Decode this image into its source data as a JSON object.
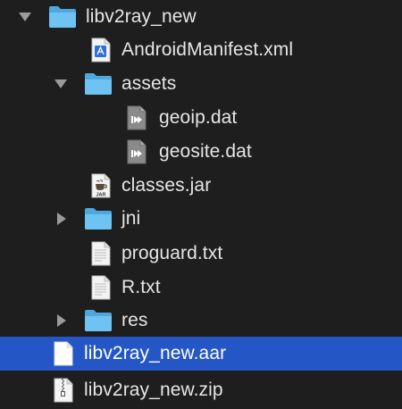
{
  "colors": {
    "background": "#1e1e1e",
    "selection": "#2457c5",
    "folder": "#6fc3f2",
    "text": "#e6e6e6"
  },
  "tree": [
    {
      "name": "libv2ray_new",
      "kind": "folder",
      "disclosure": "expanded",
      "icon": "folder-icon"
    },
    {
      "name": "AndroidManifest.xml",
      "kind": "file",
      "icon": "xml-file-icon"
    },
    {
      "name": "assets",
      "kind": "folder",
      "disclosure": "expanded",
      "icon": "folder-icon"
    },
    {
      "name": "geoip.dat",
      "kind": "file",
      "icon": "binary-file-icon"
    },
    {
      "name": "geosite.dat",
      "kind": "file",
      "icon": "binary-file-icon"
    },
    {
      "name": "classes.jar",
      "kind": "file",
      "icon": "jar-file-icon",
      "icon_text": "JAR"
    },
    {
      "name": "jni",
      "kind": "folder",
      "disclosure": "collapsed",
      "icon": "folder-icon"
    },
    {
      "name": "proguard.txt",
      "kind": "file",
      "icon": "text-file-icon"
    },
    {
      "name": "R.txt",
      "kind": "file",
      "icon": "text-file-icon"
    },
    {
      "name": "res",
      "kind": "folder",
      "disclosure": "collapsed",
      "icon": "folder-icon"
    },
    {
      "name": "libv2ray_new.aar",
      "kind": "file",
      "icon": "blank-file-icon",
      "selected": true
    },
    {
      "name": "libv2ray_new.zip",
      "kind": "file",
      "icon": "zip-file-icon"
    }
  ]
}
